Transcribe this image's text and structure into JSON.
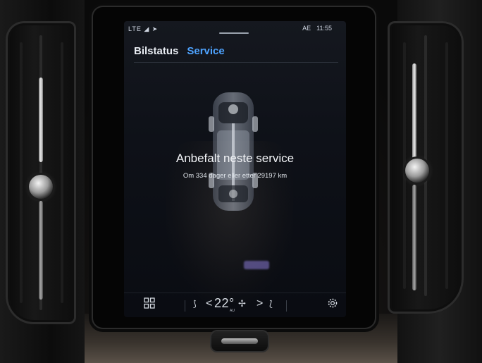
{
  "status_bar": {
    "left_indicators": "LTE ◢ ➤",
    "temp_unit": "AE",
    "time": "11:55"
  },
  "tabs": [
    {
      "label": "Bilstatus",
      "active": false
    },
    {
      "label": "Service",
      "active": true
    }
  ],
  "main": {
    "title": "Anbefalt neste service",
    "subtitle": "Om 334 dager eller etter 29197 km",
    "illustration": "car-topview-icon"
  },
  "climate_bar": {
    "home_icon": "app-grid-icon",
    "seat_left_icon": "seat-heat-icon",
    "temp_down": "<",
    "temperature": "22°",
    "fan_icon": "fan-icon",
    "temp_up": ">",
    "auto_label": "AU",
    "seat_right_icon": "seat-heat-icon",
    "settings_icon": "gear-icon"
  },
  "colors": {
    "accent": "#4ea3ff",
    "text": "#f2f4f7",
    "screen_bg": "#0e1118"
  }
}
